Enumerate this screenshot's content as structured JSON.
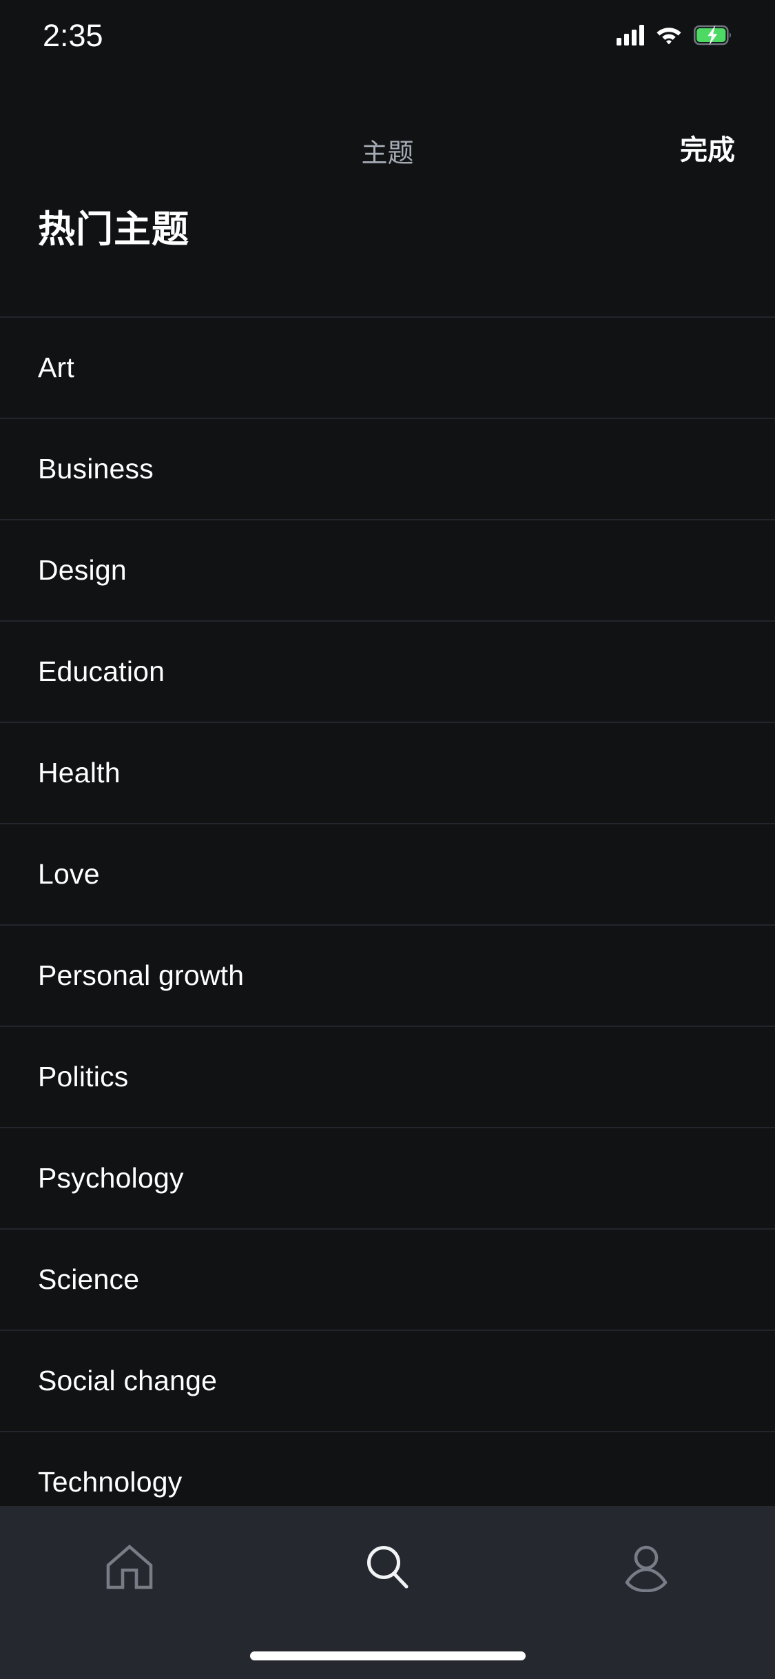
{
  "status_bar": {
    "time": "2:35",
    "signal_icon": "cellular-signal-icon",
    "wifi_icon": "wifi-icon",
    "battery_icon": "battery-charging-icon",
    "battery_color": "#4cd964",
    "signal_bars": 4
  },
  "nav_header": {
    "title": "主题",
    "title_color": "#a6acb6",
    "done_label": "完成",
    "done_color": "#ffffff"
  },
  "page": {
    "title": "热门主题",
    "background": "#111214",
    "separator_color": "#22252d"
  },
  "topics": [
    {
      "label": "Art"
    },
    {
      "label": "Business"
    },
    {
      "label": "Design"
    },
    {
      "label": "Education"
    },
    {
      "label": "Health"
    },
    {
      "label": "Love"
    },
    {
      "label": "Personal growth"
    },
    {
      "label": "Politics"
    },
    {
      "label": "Psychology"
    },
    {
      "label": "Science"
    },
    {
      "label": "Social change"
    },
    {
      "label": "Technology"
    }
  ],
  "tab_bar": {
    "background": "#26282f",
    "inactive_color": "#787c86",
    "active_color": "#f2f3f5",
    "items": [
      {
        "icon": "home-icon",
        "active": false
      },
      {
        "icon": "search-icon",
        "active": true
      },
      {
        "icon": "profile-icon",
        "active": false
      }
    ]
  },
  "home_indicator": {
    "color": "#ffffff"
  }
}
